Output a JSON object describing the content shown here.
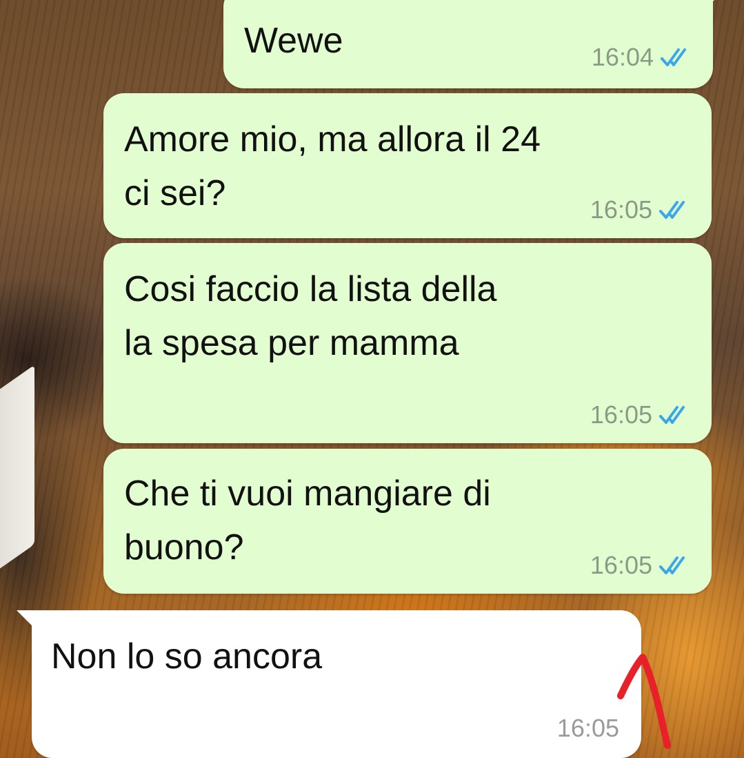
{
  "messages": [
    {
      "direction": "outgoing",
      "text": "Wewe",
      "time": "16:04",
      "status": "read"
    },
    {
      "direction": "outgoing",
      "text": "Amore mio, ma allora il 24\nci sei?",
      "time": "16:05",
      "status": "read"
    },
    {
      "direction": "outgoing",
      "text": "Cosi faccio la lista della\nla spesa per mamma",
      "time": "16:05",
      "status": "read"
    },
    {
      "direction": "outgoing",
      "text": "Che ti vuoi mangiare di\nbuono?",
      "time": "16:05",
      "status": "read"
    },
    {
      "direction": "incoming",
      "text": "Non lo so ancora",
      "time": "16:05"
    }
  ],
  "colors": {
    "outgoing_bubble": "#e2fdd0",
    "incoming_bubble": "#ffffff",
    "read_ticks": "#3aa7e8",
    "annotation_arrow": "#e8202a"
  },
  "icons": {
    "read_status": "double-check-icon",
    "annotation": "red-arrow-annotation"
  }
}
